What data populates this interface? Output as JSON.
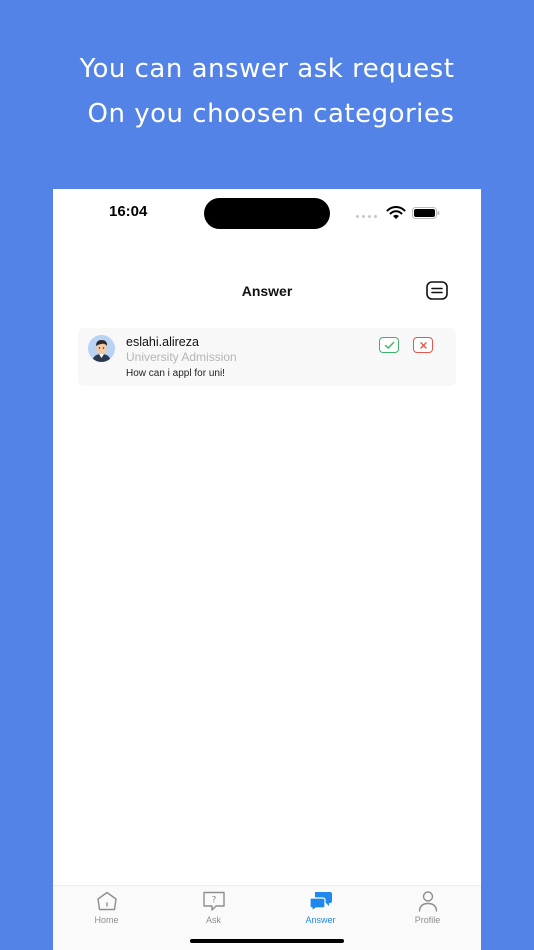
{
  "promo": {
    "line1": "You can answer ask request",
    "line2": "On you choosen categories"
  },
  "status_bar": {
    "time": "16:04"
  },
  "header": {
    "title": "Answer"
  },
  "requests": [
    {
      "username": "eslahi.alireza",
      "category": "University Admission",
      "question": "How can i appl for uni!"
    }
  ],
  "tabbar": {
    "tabs": [
      {
        "label": "Home",
        "icon": "home-icon",
        "active": false
      },
      {
        "label": "Ask",
        "icon": "question-bubble-icon",
        "active": false
      },
      {
        "label": "Answer",
        "icon": "chat-bubbles-icon",
        "active": true
      },
      {
        "label": "Profile",
        "icon": "person-icon",
        "active": false
      }
    ]
  },
  "colors": {
    "background": "#5383e6",
    "accept": "#3db36b",
    "reject": "#e0574f",
    "active_tab": "#1f88ea",
    "inactive_tab": "#8e8e8e"
  }
}
